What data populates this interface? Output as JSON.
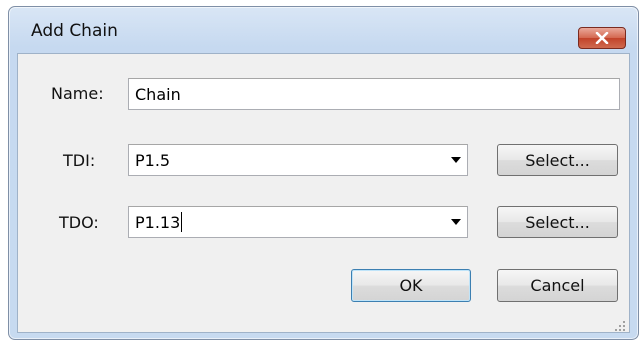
{
  "window": {
    "title": "Add Chain"
  },
  "form": {
    "name_label": "Name:",
    "name_value": "Chain",
    "tdi_label": "TDI:",
    "tdi_value": "P1.5",
    "tdo_label": "TDO:",
    "tdo_value": "P1.13"
  },
  "buttons": {
    "select_tdi": "Select...",
    "select_tdo": "Select...",
    "ok": "OK",
    "cancel": "Cancel"
  },
  "icons": {
    "close": "close-icon",
    "dropdown": "chevron-down-icon",
    "resize_grip": "resize-grip-icon"
  },
  "colors": {
    "close_button": "#c7432a",
    "title_bar": "#c6d9f0",
    "client_background": "#f0f0f0",
    "default_button_border": "#3c7fb1"
  }
}
